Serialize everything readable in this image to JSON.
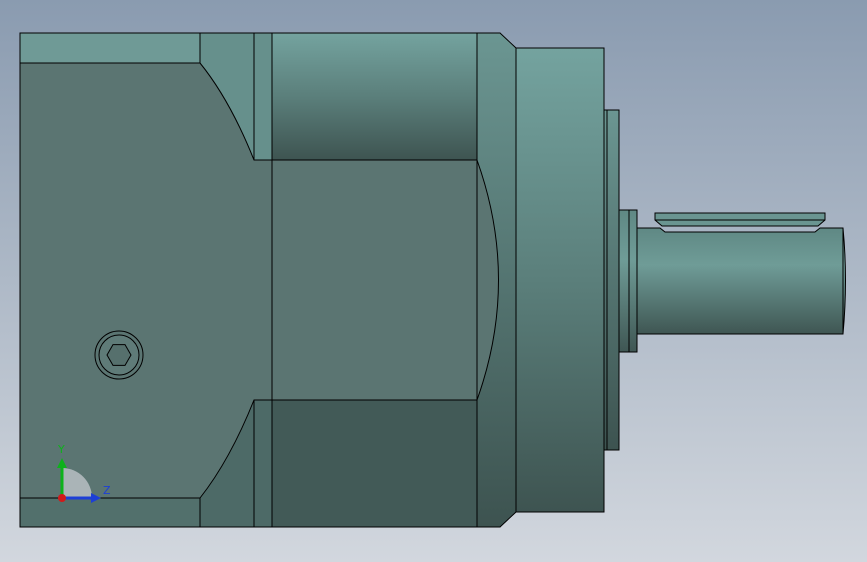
{
  "viewport": {
    "background_top": "#8a9bb0",
    "background_bottom": "#d2d7de"
  },
  "model": {
    "body_color_light": "#6f9a96",
    "body_color_dark": "#3f5552",
    "edge_color": "#000000"
  },
  "triad": {
    "y_label": "Y",
    "z_label": "Z",
    "y_color": "#0db21b",
    "z_color": "#1d3fd6",
    "x_color": "#d11a1a"
  }
}
